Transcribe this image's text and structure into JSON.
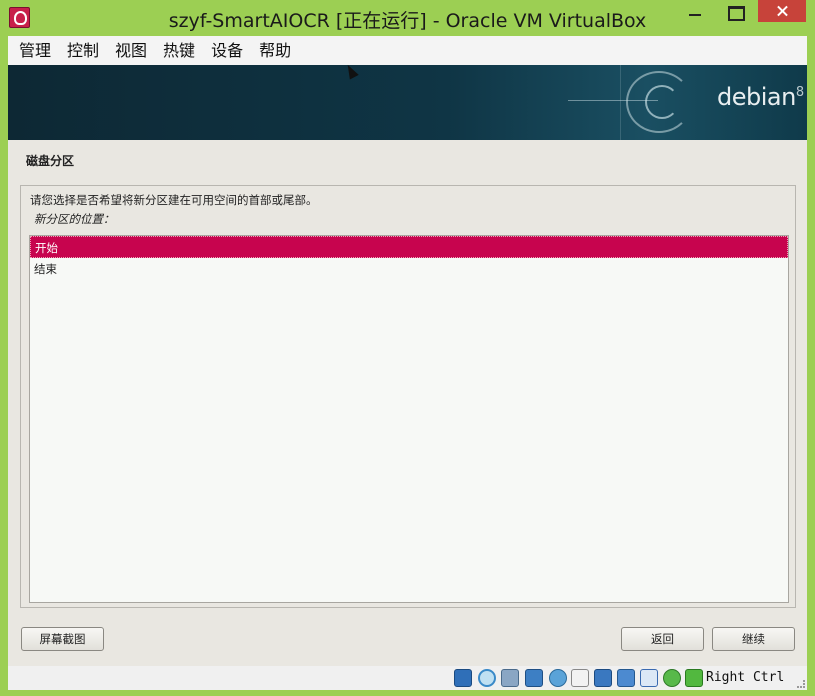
{
  "window": {
    "title": "szyf-SmartAIOCR [正在运行] - Oracle VM VirtualBox",
    "app_icon": "virtualbox-icon",
    "controls": [
      "minimize-icon",
      "maximize-icon",
      "close-icon"
    ]
  },
  "menubar": {
    "items": [
      {
        "label": "管理"
      },
      {
        "label": "控制"
      },
      {
        "label": "视图"
      },
      {
        "label": "热键"
      },
      {
        "label": "设备"
      },
      {
        "label": "帮助"
      }
    ]
  },
  "guest": {
    "banner": {
      "logo_text": "debian",
      "logo_version": "8"
    },
    "section_title": "磁盘分区",
    "prompt": "请您选择是否希望将新分区建在可用空间的首部或尾部。",
    "list_label": "新分区的位置：",
    "options": [
      {
        "label": "开始",
        "selected": true
      },
      {
        "label": "结束",
        "selected": false
      }
    ],
    "buttons": {
      "screenshot": "屏幕截图",
      "back": "返回",
      "continue": "继续"
    },
    "colors": {
      "selection": "#c7044e",
      "banner": "#0f3545"
    }
  },
  "statusbar": {
    "icons": [
      "hard-disk-icon",
      "optical-drive-icon",
      "audio-icon",
      "network-icon",
      "usb-icon",
      "shared-folder-icon",
      "display-icon",
      "video-capture-icon",
      "virtualization-icon",
      "mouse-integration-icon",
      "keyboard-capture-icon"
    ],
    "host_key": "Right Ctrl"
  }
}
